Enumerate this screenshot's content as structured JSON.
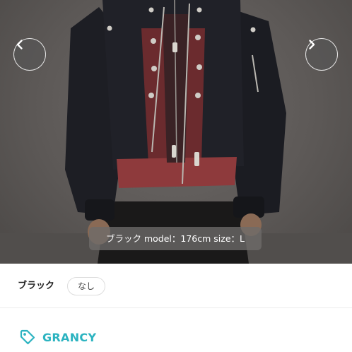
{
  "carousel": {
    "caption": "ブラック model：176cm size：L",
    "prev_icon": "chevron-left-icon",
    "next_icon": "chevron-right-icon"
  },
  "options": {
    "label": "ブラック",
    "chip": "なし"
  },
  "brand": {
    "name": "GRANCY",
    "icon": "tag-icon",
    "color": "#2bb3c0"
  }
}
